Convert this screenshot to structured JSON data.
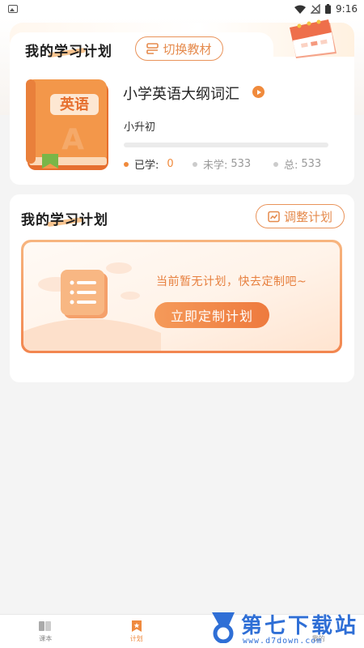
{
  "status_bar": {
    "time": "9:16"
  },
  "current_course": {
    "section_title": "我的学习计划",
    "switch_button": "切换教材",
    "book_badge": "英语",
    "book_letter": "A",
    "name": "小学英语大纲词汇",
    "level": "小升初",
    "progress": 0,
    "stats": {
      "learned_label": "已学:",
      "learned_value": "0",
      "unlearned_label": "未学:",
      "unlearned_value": "533",
      "total_label": "总:",
      "total_value": "533"
    }
  },
  "plan": {
    "section_title": "我的学习计划",
    "adjust_button": "调整计划",
    "empty_text": "当前暂无计划，快去定制吧~",
    "create_button": "立即定制计划"
  },
  "bottom_nav": [
    {
      "label": "课本",
      "icon": "book-icon",
      "active": false
    },
    {
      "label": "计划",
      "icon": "star-bookmark-icon",
      "active": true
    },
    {
      "label": "",
      "icon": "",
      "active": false
    },
    {
      "label": "我的",
      "icon": "user-icon",
      "active": false
    }
  ],
  "watermark": {
    "title": "第七下载站",
    "url": "www.d7down.com"
  },
  "colors": {
    "accent": "#ef8a3f",
    "background": "#f4f4f4"
  }
}
